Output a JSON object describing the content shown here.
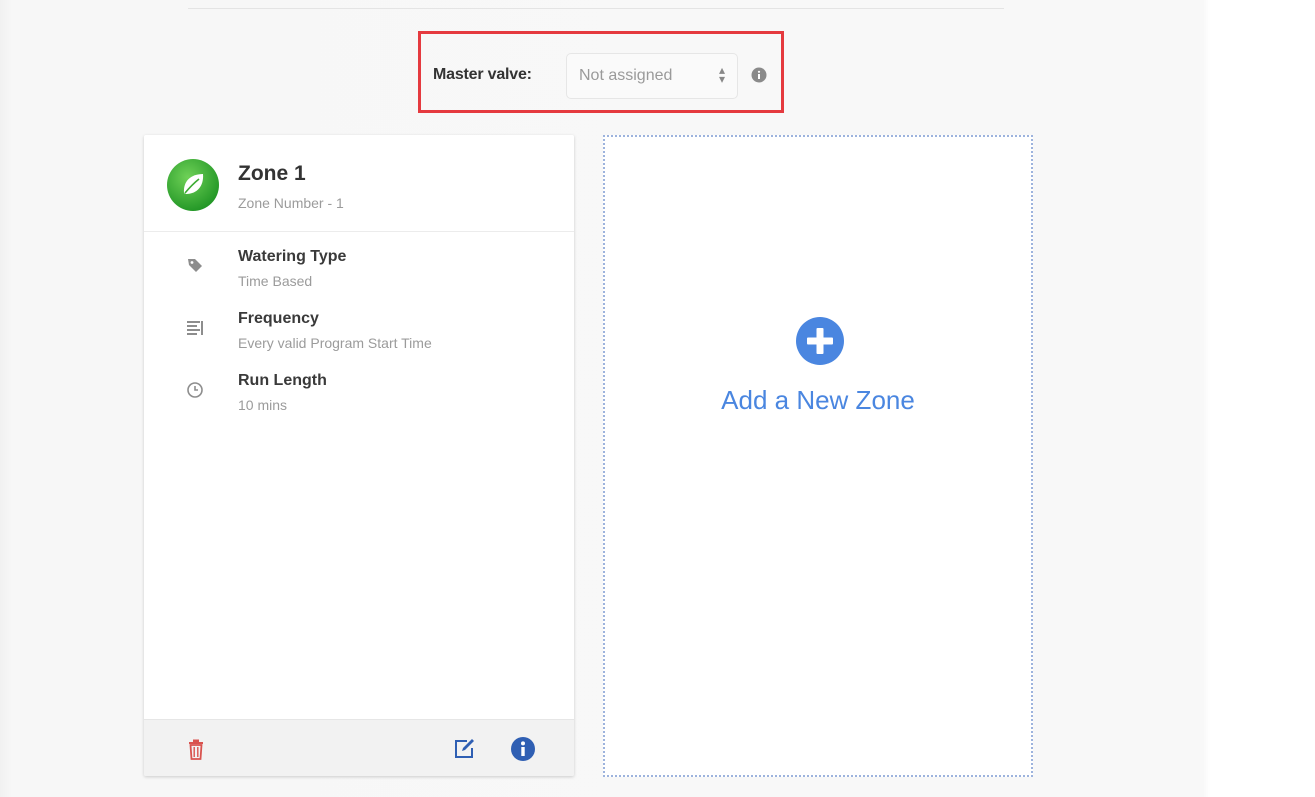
{
  "master_valve": {
    "label": "Master valve:",
    "selected_value": "Not assigned"
  },
  "zone_card": {
    "title": "Zone 1",
    "subtitle": "Zone Number - 1",
    "details": [
      {
        "label": "Watering Type",
        "value": "Time Based",
        "icon": "tag-icon"
      },
      {
        "label": "Frequency",
        "value": "Every valid Program Start Time",
        "icon": "list-icon"
      },
      {
        "label": "Run Length",
        "value": "10 mins",
        "icon": "clock-icon"
      }
    ]
  },
  "add_zone": {
    "label": "Add a New Zone"
  },
  "colors": {
    "highlight_border": "#e53a3f",
    "accent_blue": "#4a86e0",
    "zone_green": "#2ea52a",
    "delete_red": "#d9534f",
    "info_blue": "#2f5fb3"
  }
}
